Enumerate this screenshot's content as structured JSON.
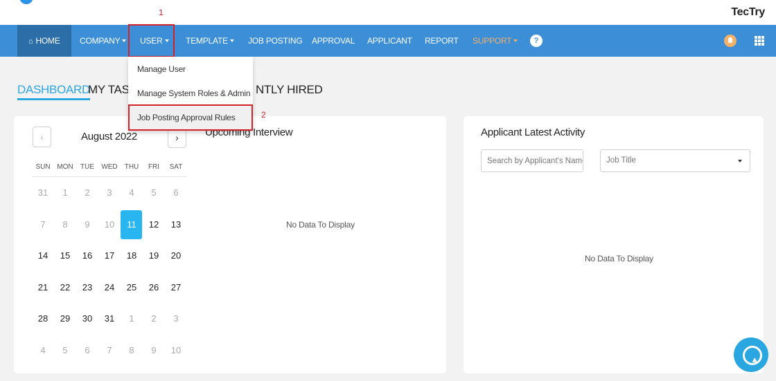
{
  "brand": "TecTry",
  "colors": {
    "nav": "#3c8fd6",
    "home": "#2b6ea8",
    "support": "#f4b16a",
    "accent": "#29b6f0",
    "annotation": "#d2232a"
  },
  "nav": {
    "home": "HOME",
    "company": "COMPANY",
    "user": "USER",
    "template": "TEMPLATE",
    "job_posting": "JOB POSTING",
    "approval": "APPROVAL",
    "applicant": "APPLICANT",
    "report": "REPORT",
    "support": "SUPPORT",
    "icons": [
      "help-person-icon",
      "lightbulb-icon",
      "apps-grid-icon"
    ]
  },
  "user_menu": {
    "items": [
      "Manage User",
      "Manage System Roles & Admin",
      "Job Posting Approval Rules"
    ]
  },
  "annotations": {
    "step1": "1",
    "step2": "2"
  },
  "tabs": {
    "dashboard": "DASHBOARD",
    "my_task": "MY TASK",
    "recently_hired": "NTLY HIRED"
  },
  "calendar": {
    "month_label": "August 2022",
    "prev": "‹",
    "next": "›",
    "weekdays": [
      "SUN",
      "MON",
      "TUE",
      "WED",
      "THU",
      "FRI",
      "SAT"
    ],
    "weeks": [
      [
        "31",
        "1",
        "2",
        "3",
        "4",
        "5",
        "6"
      ],
      [
        "7",
        "8",
        "9",
        "10",
        "11",
        "12",
        "13"
      ],
      [
        "14",
        "15",
        "16",
        "17",
        "18",
        "19",
        "20"
      ],
      [
        "21",
        "22",
        "23",
        "24",
        "25",
        "26",
        "27"
      ],
      [
        "28",
        "29",
        "30",
        "31",
        "1",
        "2",
        "3"
      ],
      [
        "4",
        "5",
        "6",
        "7",
        "8",
        "9",
        "10"
      ]
    ],
    "muted": [
      [
        0,
        0
      ],
      [
        0,
        1
      ],
      [
        0,
        2
      ],
      [
        0,
        3
      ],
      [
        0,
        4
      ],
      [
        0,
        5
      ],
      [
        0,
        6
      ],
      [
        1,
        0
      ],
      [
        1,
        1
      ],
      [
        1,
        2
      ],
      [
        1,
        3
      ],
      [
        4,
        4
      ],
      [
        4,
        5
      ],
      [
        4,
        6
      ],
      [
        5,
        0
      ],
      [
        5,
        1
      ],
      [
        5,
        2
      ],
      [
        5,
        3
      ],
      [
        5,
        4
      ],
      [
        5,
        5
      ],
      [
        5,
        6
      ]
    ],
    "today": [
      1,
      4
    ]
  },
  "upcoming": {
    "title": "Upcoming Interview",
    "empty": "No Data To Display"
  },
  "activity": {
    "title": "Applicant Latest Activity",
    "search_placeholder": "Search by Applicant's Name",
    "job_title_value": "Job Title",
    "empty": "No Data To Display"
  },
  "chat": {
    "icon": "chat-bubble-icon"
  }
}
